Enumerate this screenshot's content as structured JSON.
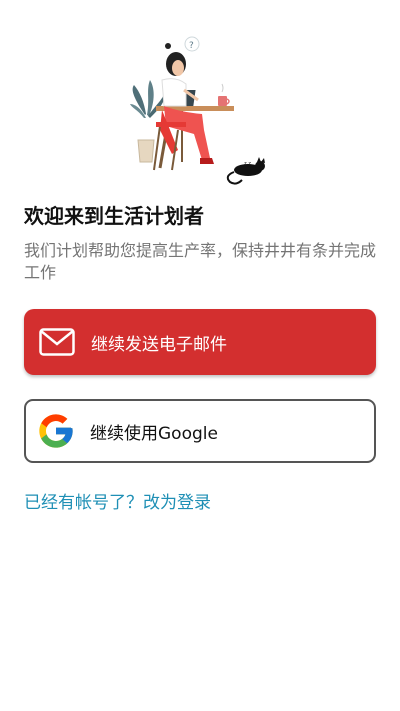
{
  "welcome": {
    "title": "欢迎来到生活计划者",
    "subtitle": "我们计划帮助您提高生产率，保持井井有条并完成工作"
  },
  "actions": {
    "email_button_label": "继续发送电子邮件",
    "google_button_label": "继续使用Google",
    "login_link_label": "已经有帐号了？改为登录"
  },
  "colors": {
    "email_button": "#d32f2f",
    "link": "#1e8fb5"
  },
  "icons": {
    "email": "envelope-icon",
    "google": "google-logo-icon",
    "illustration": "woman-at-desk-with-cat-illustration"
  }
}
